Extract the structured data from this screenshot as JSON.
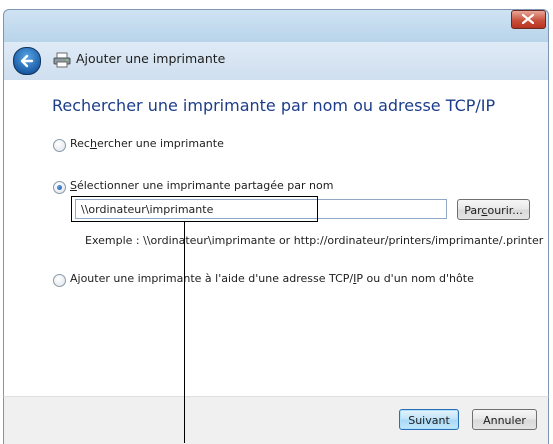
{
  "window": {
    "title": "Ajouter une imprimante"
  },
  "main": {
    "heading": "Rechercher une imprimante par nom ou adresse TCP/IP",
    "options": [
      {
        "pre": "Rec",
        "key": "h",
        "post": "ercher une imprimante",
        "checked": false
      },
      {
        "pre": "",
        "key": "S",
        "post": "électionner une imprimante partagée par nom",
        "checked": true
      },
      {
        "pre": "Ajouter une imprimante à l'aide d'une adresse TCP/",
        "key": "I",
        "post": "P ou d'un nom d'hôte",
        "checked": false
      }
    ],
    "share_input": {
      "value": "\\\\ordinateur\\imprimante"
    },
    "browse": {
      "pre": "Par",
      "key": "c",
      "post": "ourir..."
    },
    "example_text": "Exemple : \\\\ordinateur\\imprimante or http://ordinateur/printers/imprimante/.printer"
  },
  "footer": {
    "next_label": "Suivant",
    "cancel_label": "Annuler"
  }
}
